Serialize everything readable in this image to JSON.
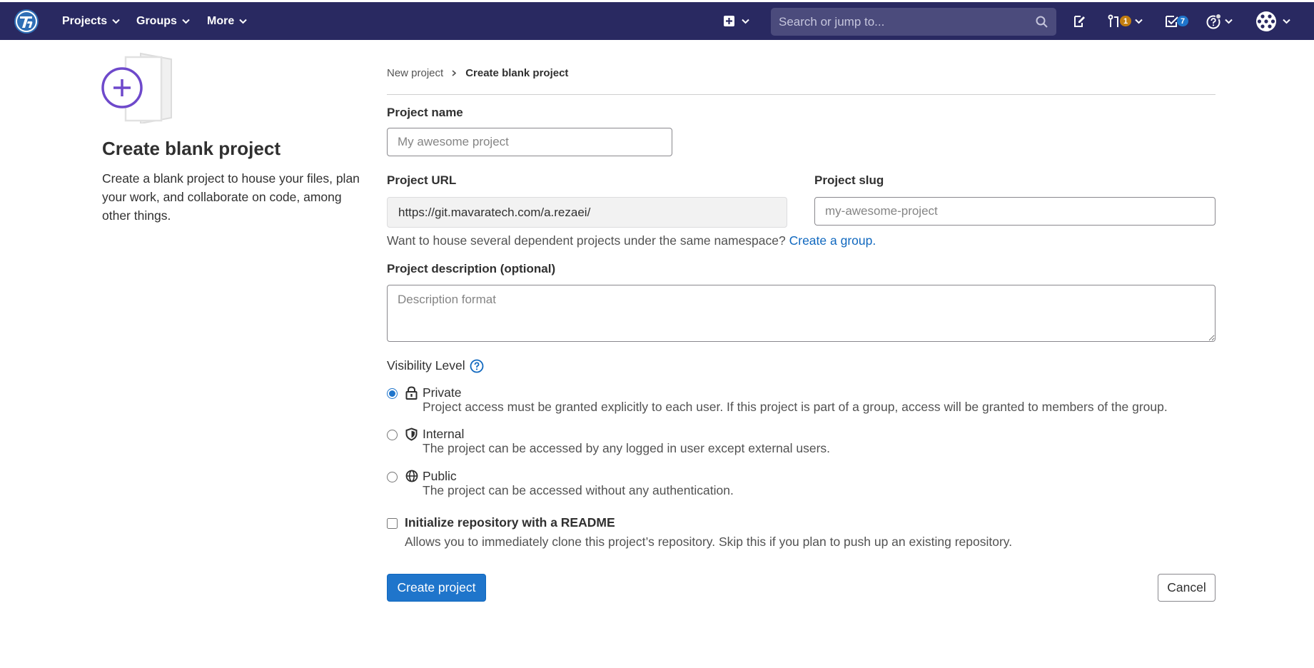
{
  "nav": {
    "logo_icon": "tanuki-logo-icon",
    "menus": [
      {
        "label": "Projects"
      },
      {
        "label": "Groups"
      },
      {
        "label": "More"
      }
    ],
    "search_placeholder": "Search or jump to...",
    "merge_requests_count": "1",
    "todos_count": "7",
    "colors": {
      "bar": "#292961",
      "mr_badge": "#c17d10",
      "todo_badge": "#1f75cb"
    }
  },
  "intro": {
    "title": "Create blank project",
    "description": "Create a blank project to house your files, plan your work, and collaborate on code, among other things."
  },
  "breadcrumb": {
    "parent": "New project",
    "current": "Create blank project"
  },
  "form": {
    "project_name_label": "Project name",
    "project_name_placeholder": "My awesome project",
    "project_url_label": "Project URL",
    "project_url_value": "https://git.mavaratech.com/a.rezaei/",
    "project_slug_label": "Project slug",
    "project_slug_placeholder": "my-awesome-project",
    "namespace_help": "Want to house several dependent projects under the same namespace?",
    "create_group_link": "Create a group.",
    "description_label": "Project description (optional)",
    "description_placeholder": "Description format",
    "visibility_label": "Visibility Level",
    "visibility_options": [
      {
        "name": "Private",
        "icon": "lock-icon",
        "description": "Project access must be granted explicitly to each user. If this project is part of a group, access will be granted to members of the group.",
        "selected": true
      },
      {
        "name": "Internal",
        "icon": "shield-icon",
        "description": "The project can be accessed by any logged in user except external users.",
        "selected": false
      },
      {
        "name": "Public",
        "icon": "globe-icon",
        "description": "The project can be accessed without any authentication.",
        "selected": false
      }
    ],
    "readme_label": "Initialize repository with a README",
    "readme_description": "Allows you to immediately clone this project’s repository. Skip this if you plan to push up an existing repository.",
    "readme_checked": false,
    "create_button": "Create project",
    "cancel_button": "Cancel",
    "accent_color": "#1f75cb"
  }
}
